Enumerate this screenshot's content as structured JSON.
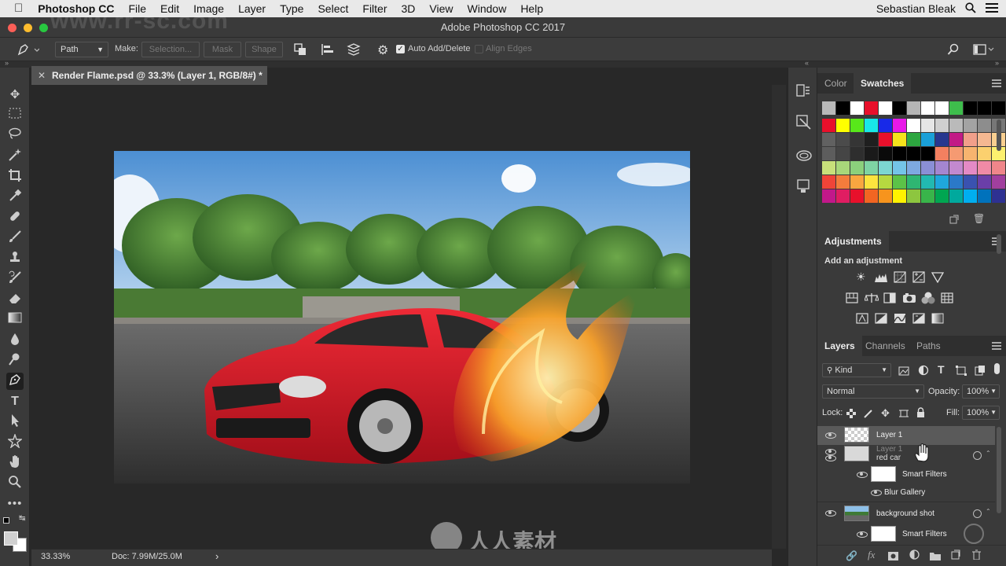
{
  "menubar": {
    "app": "Photoshop CC",
    "items": [
      "File",
      "Edit",
      "Image",
      "Layer",
      "Type",
      "Select",
      "Filter",
      "3D",
      "View",
      "Window",
      "Help"
    ],
    "user": "Sebastian Bleak"
  },
  "window": {
    "title": "Adobe Photoshop CC 2017"
  },
  "options": {
    "mode": "Path",
    "make_label": "Make:",
    "selection": "Selection...",
    "mask": "Mask",
    "shape": "Shape",
    "auto_add": "Auto Add/Delete",
    "align_edges": "Align Edges"
  },
  "document": {
    "tab_title": "Render Flame.psd @ 33.3% (Layer 1, RGB/8#) *",
    "zoom": "33.33%",
    "doc_size": "Doc: 7.99M/25.0M"
  },
  "color_panel": {
    "tabs": [
      "Color",
      "Swatches"
    ],
    "active": "Swatches"
  },
  "swatches": {
    "row0": [
      "#b9b9b9",
      "#000000",
      "#ffffff",
      "#e8102b",
      "#ffffff",
      "#000000",
      "#b5b5b5",
      "#ffffff",
      "#ffffff",
      "#3ebd4c",
      "#000000",
      "#000000",
      "#000000"
    ],
    "rows": [
      [
        "#e8102b",
        "#ffff00",
        "#58e81a",
        "#18e8e8",
        "#1829e8",
        "#e818e8",
        "#ffffff",
        "#e6e6e6",
        "#d0d0d0",
        "#bababa",
        "#a3a3a3",
        "#8d8d8d",
        "#777777"
      ],
      [
        "#616161",
        "#4b4b4b",
        "#353535",
        "#1f1f1f",
        "#e8102b",
        "#f5e31c",
        "#2da640",
        "#1aa0d8",
        "#27378f",
        "#c21a86",
        "#f19f8a",
        "#f5b891",
        "#f9cf90"
      ],
      [
        "#5d5d5d",
        "#454545",
        "#2e2e2e",
        "#1a1a1a",
        "#0a0a0a",
        "#000000",
        "#000000",
        "#000000",
        "#f38060",
        "#f59a72",
        "#f7b46f",
        "#fbd06e",
        "#fdf06e"
      ],
      [
        "#c8e07a",
        "#a8d77a",
        "#8bd07c",
        "#7ed3a4",
        "#7cd6d0",
        "#74c4e8",
        "#7ea9e0",
        "#8a8fd6",
        "#a486d0",
        "#c389cf",
        "#e48ac5",
        "#f08aa6",
        "#f0868a"
      ],
      [
        "#f04438",
        "#f47c3c",
        "#f9a640",
        "#fce33e",
        "#b6d840",
        "#5cc248",
        "#2fb672",
        "#22b9b0",
        "#1fa7dc",
        "#2b79c8",
        "#3a52b0",
        "#6a3fa8",
        "#a13f9e"
      ],
      [
        "#c2188a",
        "#e01d62",
        "#e8102b",
        "#f26522",
        "#f7941d",
        "#fff200",
        "#8dc63f",
        "#39b54a",
        "#00a651",
        "#00a99d",
        "#00aeef",
        "#0072bc",
        "#2e3192"
      ]
    ]
  },
  "adjustments": {
    "title": "Adjustments",
    "subtitle": "Add an adjustment"
  },
  "layers_panel": {
    "tabs": [
      "Layers",
      "Channels",
      "Paths"
    ],
    "filter_kind": "Kind",
    "blend_mode": "Normal",
    "opacity_label": "Opacity:",
    "opacity": "100%",
    "lock_label": "Lock:",
    "fill_label": "Fill:",
    "fill": "100%",
    "layers": [
      {
        "name": "Layer 1"
      },
      {
        "name": "Layer 1"
      },
      {
        "name": "red car"
      },
      {
        "name": "Smart Filters"
      },
      {
        "name": "Blur Gallery"
      },
      {
        "name": "background shot"
      },
      {
        "name": "Smart Filters"
      }
    ]
  },
  "watermark": {
    "text": "www.rr-sc.com",
    "brand": "人人素材"
  }
}
